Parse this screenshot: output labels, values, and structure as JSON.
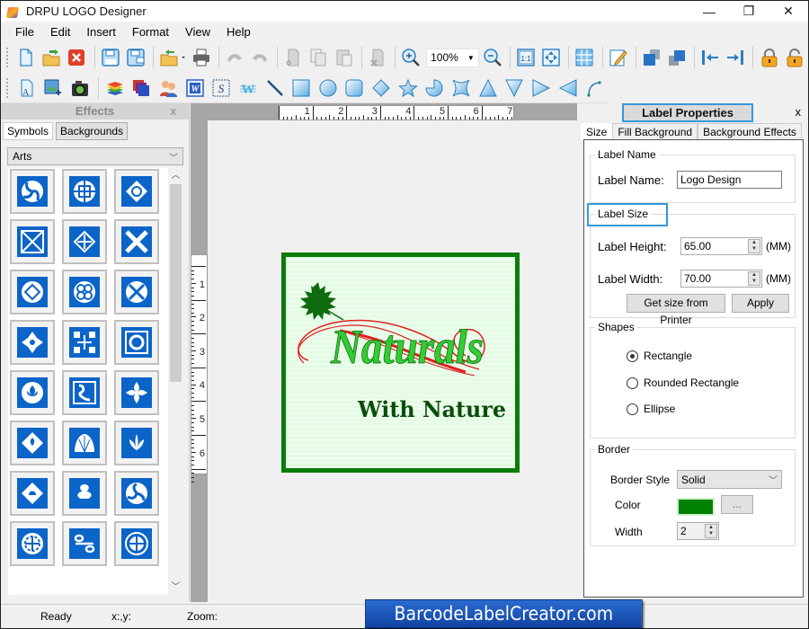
{
  "window": {
    "title": "DRPU LOGO Designer",
    "controls": {
      "minimize": "—",
      "restore": "❐",
      "close": "✕"
    }
  },
  "menu": [
    "File",
    "Edit",
    "Insert",
    "Format",
    "View",
    "Help"
  ],
  "toolbar1": {
    "buttons": [
      "new-icon",
      "open-icon",
      "close-file-icon",
      "save-icon",
      "save-as-icon",
      "import-icon",
      "print-icon",
      "undo-icon",
      "redo-icon",
      "cut-icon",
      "copy-icon",
      "paste-icon",
      "delete-icon",
      "zoom-in-icon",
      "zoom-out-icon",
      "actual-size-icon",
      "fit-to-window-icon",
      "grid-icon",
      "edit-icon",
      "bring-to-front-icon",
      "send-to-back-icon",
      "align-left-icon",
      "align-right-icon",
      "lock-icon",
      "unlock-icon"
    ],
    "zoom_value": "100%"
  },
  "toolbar2": {
    "buttons": [
      "text-icon",
      "image-icon",
      "camera-icon",
      "layers-icon",
      "background-icon",
      "users-icon",
      "word-art-icon",
      "signature-icon",
      "watermark-icon",
      "line-icon",
      "rectangle-icon",
      "ellipse-icon",
      "rounded-rectangle-icon",
      "diamond-icon",
      "star-icon",
      "pie-icon",
      "cross-shape-icon",
      "triangle-up-icon",
      "triangle-down-icon",
      "triangle-right-icon",
      "triangle-left-icon",
      "arc-icon"
    ]
  },
  "effects": {
    "title": "Effects",
    "close": "x",
    "tabs": [
      "Symbols",
      "Backgrounds"
    ],
    "active_tab": "Symbols",
    "category": "Arts",
    "symbol_count": 24
  },
  "canvas": {
    "ruler_h": [
      "1",
      "2",
      "3",
      "4",
      "5",
      "6",
      "7"
    ],
    "ruler_v": [
      "1",
      "2",
      "3",
      "4",
      "5",
      "6"
    ],
    "logo": {
      "title": "Naturals",
      "subtitle": "With Nature",
      "border_color": "#0a7d0a",
      "background": "#e4fbe4"
    }
  },
  "properties": {
    "title": "Label Properties",
    "close": "x",
    "tabs": [
      "Size",
      "Fill Background",
      "Background Effects"
    ],
    "active_tab": "Size",
    "label_name_group": "Label Name",
    "label_name_label": "Label Name:",
    "label_name_value": "Logo Design",
    "label_size_group": "Label Size",
    "height_label": "Label Height:",
    "height_value": "65.00",
    "width_label": "Label Width:",
    "width_value": "70.00",
    "unit": "(MM)",
    "get_size_button": "Get size from Printer",
    "apply_button": "Apply",
    "shapes_group": "Shapes",
    "shapes": [
      {
        "label": "Rectangle",
        "selected": true
      },
      {
        "label": "Rounded Rectangle",
        "selected": false
      },
      {
        "label": "Ellipse",
        "selected": false
      }
    ],
    "border_group": "Border",
    "border_style_label": "Border Style",
    "border_style_value": "Solid",
    "color_label": "Color",
    "color_value": "#008000",
    "color_button": "...",
    "width_field_label": "Width",
    "border_width_value": "2"
  },
  "status": {
    "ready": "Ready",
    "coords": "x:,y:",
    "zoom": "Zoom:"
  },
  "watermark": "BarcodeLabelCreator.com"
}
